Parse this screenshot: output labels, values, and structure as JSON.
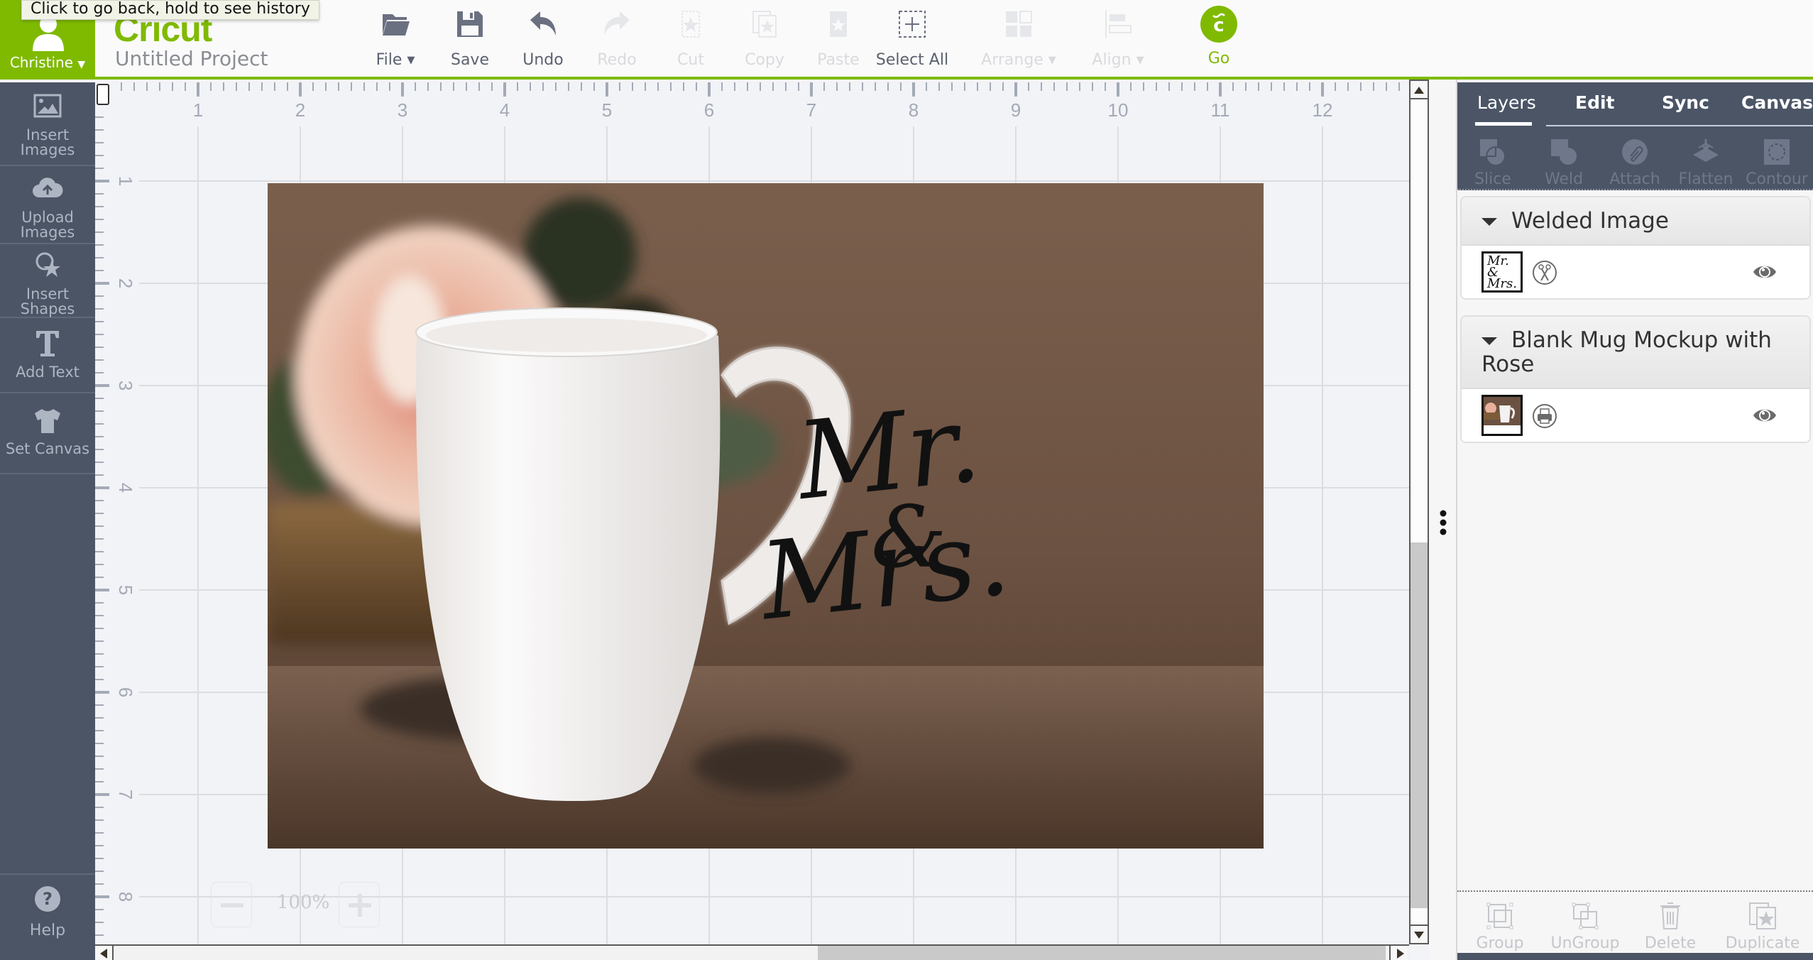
{
  "tooltip": "Click to go back, hold to see history",
  "user": {
    "name": "Christine",
    "icon": "user-icon",
    "dropdown_icon": "caret-down-icon"
  },
  "brand": {
    "logo_text": "Cricut",
    "color": "#7fba00"
  },
  "project": {
    "title": "Untitled Project"
  },
  "toolbar": {
    "items": [
      {
        "id": "file",
        "label": "File ▾",
        "icon": "folder-icon",
        "enabled": true
      },
      {
        "id": "save",
        "label": "Save",
        "icon": "save-icon",
        "enabled": true
      },
      {
        "id": "undo",
        "label": "Undo",
        "icon": "undo-icon",
        "enabled": true
      },
      {
        "id": "redo",
        "label": "Redo",
        "icon": "redo-icon",
        "enabled": false
      },
      {
        "id": "cut",
        "label": "Cut",
        "icon": "cut-icon",
        "enabled": false
      },
      {
        "id": "copy",
        "label": "Copy",
        "icon": "copy-icon",
        "enabled": false
      },
      {
        "id": "paste",
        "label": "Paste",
        "icon": "paste-icon",
        "enabled": false
      },
      {
        "id": "select_all",
        "label": "Select All",
        "icon": "select-all-icon",
        "enabled": true
      },
      {
        "id": "arrange",
        "label": "Arrange ▾",
        "icon": "arrange-icon",
        "enabled": false
      },
      {
        "id": "align",
        "label": "Align ▾",
        "icon": "align-icon",
        "enabled": false
      }
    ],
    "go": {
      "label": "Go",
      "icon": "cricut-go-icon",
      "color": "#7fba00"
    }
  },
  "sidebar": {
    "items": [
      {
        "label_lines": [
          "Insert",
          "Images"
        ],
        "icon": "image-icon"
      },
      {
        "label_lines": [
          "Upload",
          "Images"
        ],
        "icon": "cloud-upload-icon"
      },
      {
        "label_lines": [
          "Insert",
          "Shapes"
        ],
        "icon": "shapes-icon"
      },
      {
        "label_lines": [
          "Add Text"
        ],
        "icon": "text-icon"
      },
      {
        "label_lines": [
          "Set Canvas"
        ],
        "icon": "tshirt-icon"
      }
    ],
    "help": {
      "label": "Help",
      "icon": "help-icon"
    }
  },
  "canvas": {
    "ruler_h_labels": [
      "1",
      "2",
      "3",
      "4",
      "5",
      "6",
      "7",
      "8",
      "9",
      "10",
      "11",
      "12"
    ],
    "ruler_v_labels": [
      "1",
      "2",
      "3",
      "4",
      "5",
      "6",
      "7",
      "8"
    ],
    "image_text_line1": "Mr.",
    "image_text_amp": "&",
    "image_text_line2": "Mrs.",
    "zoom": {
      "value": "100%",
      "minus_icon": "zoom-out-icon",
      "plus_icon": "zoom-in-icon"
    }
  },
  "right_panel": {
    "tabs": [
      {
        "label": "Layers",
        "active": true
      },
      {
        "label": "Edit",
        "active": false
      },
      {
        "label": "Sync",
        "active": false
      },
      {
        "label": "Canvas",
        "active": false
      }
    ],
    "tools": [
      {
        "label": "Slice",
        "icon": "slice-icon"
      },
      {
        "label": "Weld",
        "icon": "weld-icon"
      },
      {
        "label": "Attach",
        "icon": "attach-icon"
      },
      {
        "label": "Flatten",
        "icon": "flatten-icon"
      },
      {
        "label": "Contour",
        "icon": "contour-icon"
      }
    ],
    "layers": [
      {
        "name": "Welded Image",
        "operation": "cut",
        "operation_icon": "scissors-icon",
        "visible": true
      },
      {
        "name": "Blank Mug Mockup with Rose",
        "operation": "print",
        "operation_icon": "printer-icon",
        "visible": true
      }
    ],
    "footer_tools": [
      {
        "label": "Group",
        "icon": "group-icon"
      },
      {
        "label": "UnGroup",
        "icon": "ungroup-icon"
      },
      {
        "label": "Delete",
        "icon": "trash-icon"
      },
      {
        "label": "Duplicate",
        "icon": "duplicate-icon"
      }
    ]
  }
}
